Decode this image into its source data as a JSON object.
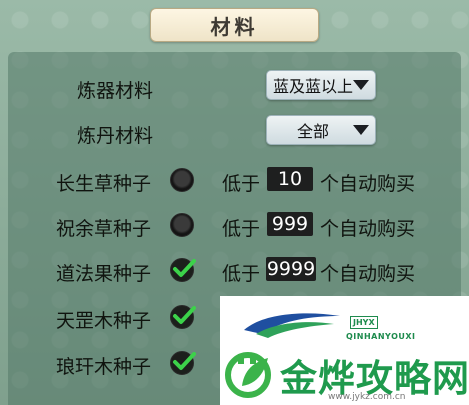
{
  "dialog": {
    "title": "材料"
  },
  "material_filters": [
    {
      "label": "炼器材料",
      "selected": "蓝及蓝以上"
    },
    {
      "label": "炼丹材料",
      "selected": "全部"
    }
  ],
  "seed_rows": [
    {
      "label": "长生草种子",
      "checked": false,
      "prefix": "低于",
      "value": "10",
      "suffix": "个自动购买"
    },
    {
      "label": "祝余草种子",
      "checked": false,
      "prefix": "低于",
      "value": "999",
      "suffix": "个自动购买"
    },
    {
      "label": "道法果种子",
      "checked": true,
      "prefix": "低于",
      "value": "9999",
      "suffix": "个自动购买"
    },
    {
      "label": "天罡木种子",
      "checked": true
    },
    {
      "label": "琅玕木种子",
      "checked": true
    }
  ],
  "watermark": {
    "brand_box": "JHYX",
    "brand_en": "QINHANYOUXI",
    "brand_cn": "金烨攻略网",
    "url": "www.jykz.com.cn"
  },
  "colors": {
    "panel": "#547868",
    "check": "#3cd24a",
    "watermark_green": "#1f9a4d"
  }
}
